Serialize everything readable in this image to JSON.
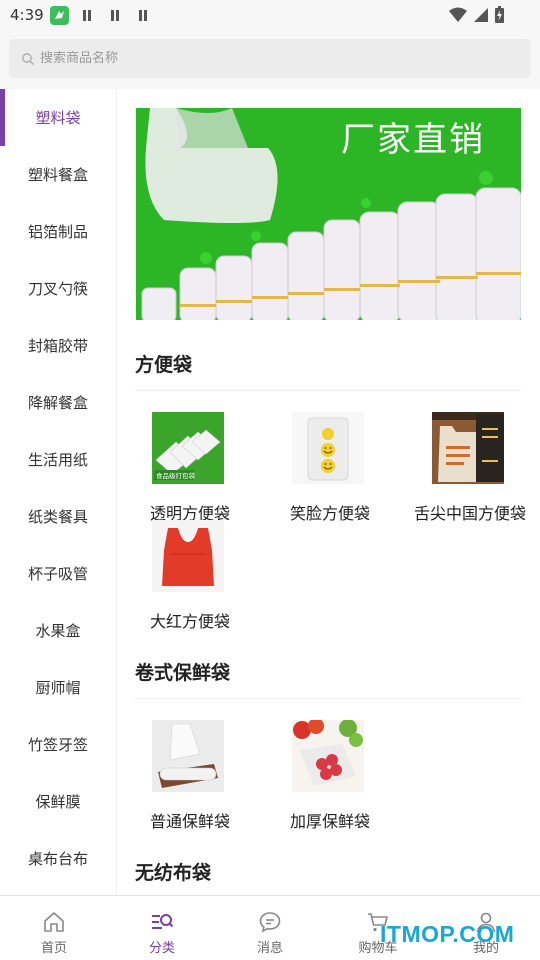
{
  "status_bar": {
    "time": "4:39"
  },
  "search": {
    "placeholder": "搜索商品名称"
  },
  "sidebar": {
    "items": [
      {
        "label": "塑料袋",
        "active": true
      },
      {
        "label": "塑料餐盒"
      },
      {
        "label": "铝箔制品"
      },
      {
        "label": "刀叉勺筷"
      },
      {
        "label": "封箱胶带"
      },
      {
        "label": "降解餐盒"
      },
      {
        "label": "生活用纸"
      },
      {
        "label": "纸类餐具"
      },
      {
        "label": "杯子吸管"
      },
      {
        "label": "水果盒"
      },
      {
        "label": "厨师帽"
      },
      {
        "label": "竹签牙签"
      },
      {
        "label": "保鲜膜"
      },
      {
        "label": "桌布台布"
      }
    ]
  },
  "banner": {
    "title": "厂家直销",
    "color": "#2cb625"
  },
  "sections": [
    {
      "title": "方便袋",
      "products": [
        {
          "name": "透明方便袋",
          "thumb_label": "食品级打包袋"
        },
        {
          "name": "笑脸方便袋"
        },
        {
          "name": "舌尖中国方便袋"
        },
        {
          "name": "大红方便袋"
        }
      ]
    },
    {
      "title": "卷式保鲜袋",
      "products": [
        {
          "name": "普通保鲜袋"
        },
        {
          "name": "加厚保鲜袋"
        }
      ]
    },
    {
      "title": "无纺布袋",
      "products": []
    }
  ],
  "bottom_nav": [
    {
      "label": "首页",
      "icon": "home-icon"
    },
    {
      "label": "分类",
      "icon": "category-icon",
      "active": true
    },
    {
      "label": "消息",
      "icon": "message-icon"
    },
    {
      "label": "购物车",
      "icon": "cart-icon"
    },
    {
      "label": "我的",
      "icon": "user-icon"
    }
  ],
  "watermark": "ITMOP.COM",
  "colors": {
    "accent": "#7b3fa6",
    "watermark": "#18a7d6"
  }
}
